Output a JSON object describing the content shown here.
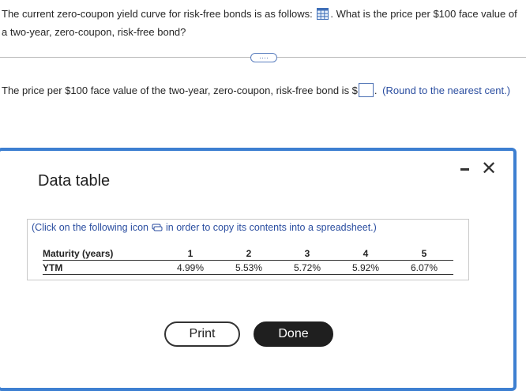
{
  "question": {
    "text_before_icon": "The current zero-coupon yield curve for risk-free bonds is as follows:",
    "icon": "table-grid-icon",
    "text_after_icon": ". What is the price per $100 face value of a two-year, zero-coupon, risk-free bond?"
  },
  "more_button": {
    "label": "····"
  },
  "answer": {
    "prefix": "The price per $100 face value of the two-year, zero-coupon, risk-free bond is $",
    "input_value": "",
    "suffix": ".",
    "note": "(Round to the nearest cent.)"
  },
  "dialog": {
    "title": "Data table",
    "minimize_icon": "minimize-icon",
    "close_icon": "close-icon",
    "close_glyph": "✕",
    "instruction_before": "(Click on the following icon",
    "instruction_icon": "copy-icon",
    "instruction_after": "in order to copy its contents into a spreadsheet.)",
    "table": {
      "row_headers": [
        "Maturity (years)",
        "YTM"
      ],
      "maturities": [
        "1",
        "2",
        "3",
        "4",
        "5"
      ],
      "ytm": [
        "4.99%",
        "5.53%",
        "5.72%",
        "5.92%",
        "6.07%"
      ]
    },
    "print_label": "Print",
    "done_label": "Done"
  },
  "colors": {
    "accent_blue": "#3d7fd1",
    "link_blue": "#2b4ea0",
    "done_button": "#1f1f1f"
  }
}
